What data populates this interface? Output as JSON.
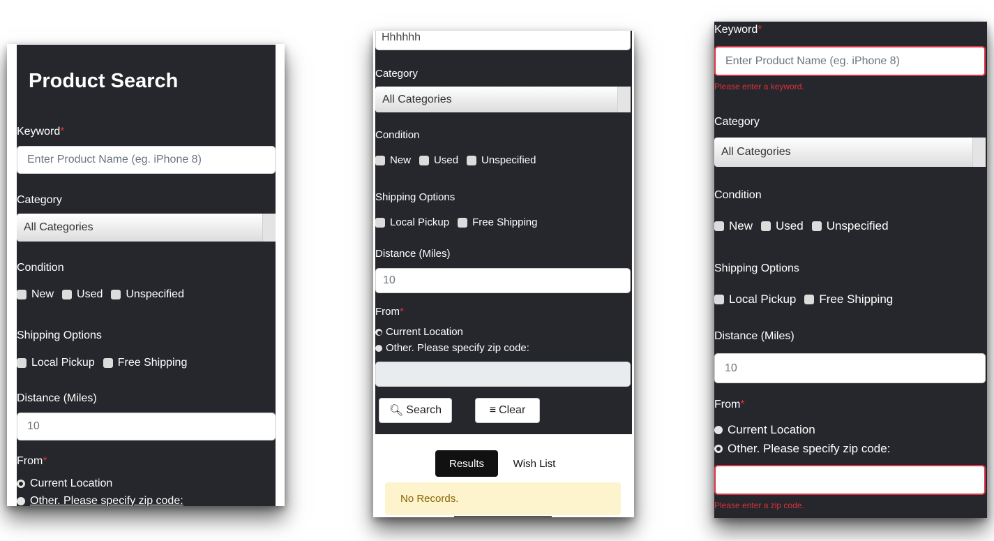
{
  "screen1": {
    "title": "Product Search",
    "keyword_label": "Keyword",
    "required_mark": "*",
    "keyword_placeholder": "Enter Product Name (eg. iPhone 8)",
    "category_label": "Category",
    "category_value": "All Categories",
    "condition_label": "Condition",
    "conditions": [
      "New",
      "Used",
      "Unspecified"
    ],
    "shipping_label": "Shipping Options",
    "shipping": [
      "Local Pickup",
      "Free Shipping"
    ],
    "distance_label": "Distance (Miles)",
    "distance_placeholder": "10",
    "from_label": "From",
    "from_options": [
      "Current Location",
      "Other. Please specify zip code:"
    ],
    "from_selected": 0
  },
  "screen2": {
    "keyword_value": "Hhhhhh",
    "category_label": "Category",
    "category_value": "All Categories",
    "condition_label": "Condition",
    "conditions": [
      "New",
      "Used",
      "Unspecified"
    ],
    "shipping_label": "Shipping Options",
    "shipping": [
      "Local Pickup",
      "Free Shipping"
    ],
    "distance_label": "Distance (Miles)",
    "distance_placeholder": "10",
    "from_label": "From",
    "required_mark": "*",
    "from_options": [
      "Current Location",
      "Other. Please specify zip code:"
    ],
    "from_selected": 0,
    "search_button": "Search",
    "clear_button": "Clear",
    "tab_results": "Results",
    "tab_wishlist": "Wish List",
    "no_records": "No Records."
  },
  "screen3": {
    "keyword_label": "Keyword",
    "required_mark": "*",
    "keyword_placeholder": "Enter Product Name (eg. iPhone 8)",
    "keyword_error": "Please enter a keyword.",
    "category_label": "Category",
    "category_value": "All Categories",
    "condition_label": "Condition",
    "conditions": [
      "New",
      "Used",
      "Unspecified"
    ],
    "shipping_label": "Shipping Options",
    "shipping": [
      "Local Pickup",
      "Free Shipping"
    ],
    "distance_label": "Distance (Miles)",
    "distance_placeholder": "10",
    "from_label": "From",
    "from_options": [
      "Current Location",
      "Other. Please specify zip code:"
    ],
    "from_selected": 1,
    "zip_error": "Please enter a zip code."
  },
  "colors": {
    "panel_bg": "#25272c",
    "required": "#e0303a",
    "error_border": "#dc3545",
    "alert_bg": "#fdf3cd"
  }
}
